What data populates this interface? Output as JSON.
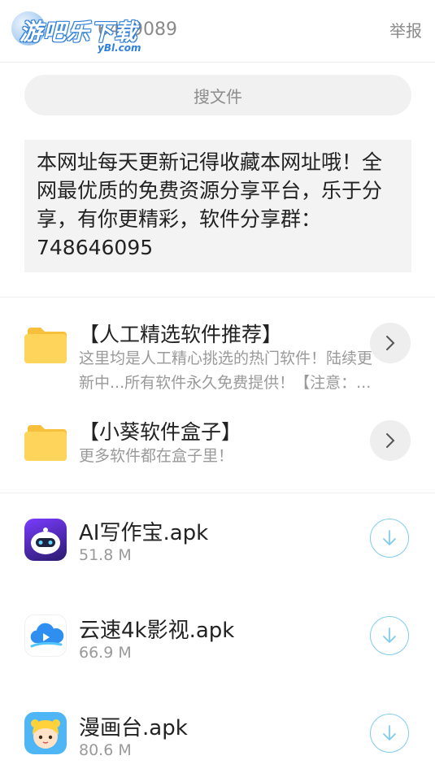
{
  "header": {
    "watermark_text": "游吧乐下载",
    "watermark_sub": "yBl.com",
    "share_id": "6449089",
    "report_label": "举报"
  },
  "search": {
    "placeholder": "搜文件"
  },
  "notice": {
    "text": "本网址每天更新记得收藏本网址哦！全网最优质的免费资源分享平台，乐于分享，有你更精彩，软件分享群：748646095"
  },
  "folders": [
    {
      "title": "【人工精选软件推荐】",
      "description": "这里均是人工精心挑选的热门软件！陆续更新中...所有软件永久免费提供！【注意：...",
      "icon": "folder-icon"
    },
    {
      "title": "【小葵软件盒子】",
      "description": "更多软件都在盒子里！",
      "icon": "folder-icon"
    }
  ],
  "files": [
    {
      "name": "AI写作宝.apk",
      "size": "51.8 M",
      "icon": "robot-app-icon"
    },
    {
      "name": "云速4k影视.apk",
      "size": "66.9 M",
      "icon": "cloud-app-icon"
    },
    {
      "name": "漫画台.apk",
      "size": "80.6 M",
      "icon": "anime-girl-app-icon"
    }
  ],
  "colors": {
    "folder": "#FFD45A",
    "download_accent": "#7FCDF0",
    "text_secondary": "#9A9A9A",
    "watermark_blue": "#2F7FD8"
  }
}
